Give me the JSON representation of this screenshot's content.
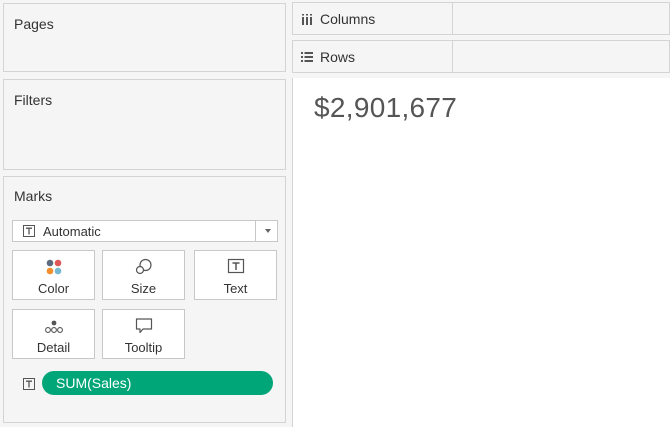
{
  "pages": {
    "title": "Pages"
  },
  "filters": {
    "title": "Filters"
  },
  "marks": {
    "title": "Marks",
    "mark_type": {
      "label": "Automatic",
      "icon": "text-mark-icon"
    },
    "buttons": [
      {
        "label": "Color",
        "icon": "color-icon"
      },
      {
        "label": "Size",
        "icon": "size-icon"
      },
      {
        "label": "Text",
        "icon": "text-icon"
      },
      {
        "label": "Detail",
        "icon": "detail-icon"
      },
      {
        "label": "Tooltip",
        "icon": "tooltip-icon"
      }
    ],
    "fields": [
      {
        "label": "SUM(Sales)",
        "encoding_icon": "text-mark-icon",
        "color": "#00a678"
      }
    ]
  },
  "shelves": {
    "columns": {
      "label": "Columns",
      "icon": "columns-icon"
    },
    "rows": {
      "label": "Rows",
      "icon": "rows-icon"
    }
  },
  "view": {
    "value": "$2,901,677"
  },
  "colors": {
    "pill": "#00a678",
    "color_icon_dots": [
      "#5b6b7d",
      "#e05759",
      "#f28e2b",
      "#76b7d2"
    ]
  }
}
